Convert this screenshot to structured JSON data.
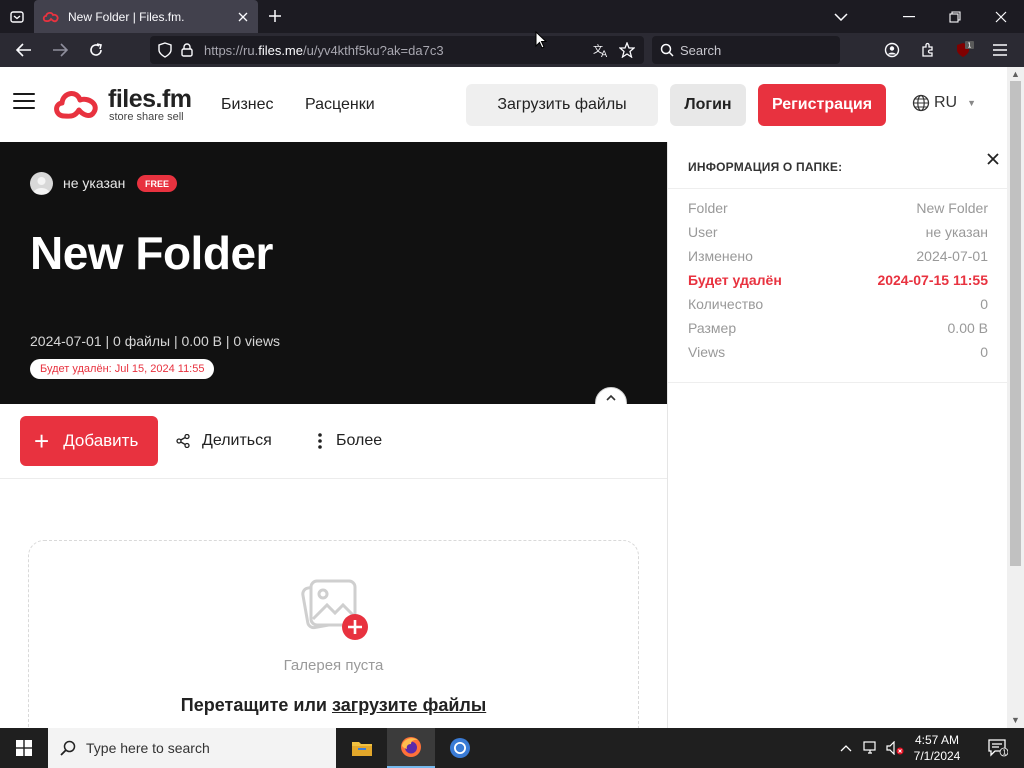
{
  "browser": {
    "tab_title": "New Folder | Files.fm.",
    "url_prefix": "https://ru.",
    "url_domain": "files.me",
    "url_rest": "/u/yv4kthf5ku?ak=da7c3",
    "search_placeholder": "Search",
    "extension_badge": "1"
  },
  "header": {
    "logo_name": "files.fm",
    "logo_tagline": "store share sell",
    "nav": [
      "Бизнес",
      "Расценки"
    ],
    "upload_label": "Загрузить файлы",
    "login_label": "Логин",
    "register_label": "Регистрация",
    "language": "RU"
  },
  "folder": {
    "owner": "не указан",
    "plan_badge": "FREE",
    "title": "New Folder",
    "meta": "2024-07-01 | 0 файлы | 0.00  B | 0 views",
    "deletion_badge": "Будет удалён: Jul 15, 2024 11:55"
  },
  "toolbar": {
    "add_label": "Добавить",
    "share_label": "Делиться",
    "more_label": "Более"
  },
  "gallery": {
    "empty_text": "Галерея пуста",
    "drag_prefix": "Перетащите или ",
    "drag_link": "загрузите файлы"
  },
  "sidebar": {
    "heading": "ИНФОРМАЦИЯ О ПАПКЕ:",
    "rows": [
      {
        "key": "Folder",
        "value": "New Folder"
      },
      {
        "key": "User",
        "value": "не указан"
      },
      {
        "key": "Изменено",
        "value": "2024-07-01"
      },
      {
        "key": "Будет удалён",
        "value": "2024-07-15 11:55"
      },
      {
        "key": "Количество",
        "value": "0"
      },
      {
        "key": "Размер",
        "value": "0.00  B"
      },
      {
        "key": "Views",
        "value": "0"
      }
    ]
  },
  "taskbar": {
    "search_placeholder": "Type here to search",
    "time": "4:57 AM",
    "date": "7/1/2024",
    "notification_count": "1"
  },
  "colors": {
    "brand_red": "#e8323f",
    "hero_bg": "#111111",
    "browser_dark": "#1c1b22"
  }
}
